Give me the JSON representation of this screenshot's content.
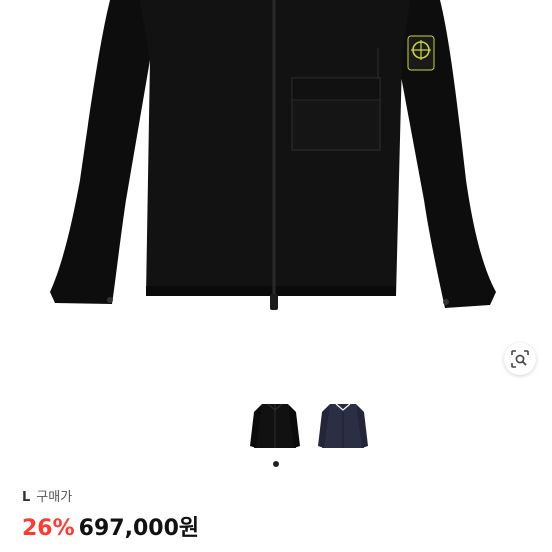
{
  "product": {
    "image_alt": "black zip-up overshirt jacket with compass badge on left sleeve"
  },
  "gallery": {
    "lens_icon": "image-search-icon",
    "thumbnails": [
      {
        "name": "black",
        "color": "#111111"
      },
      {
        "name": "navy",
        "color": "#2b2f45"
      }
    ],
    "active_index": 0
  },
  "listing": {
    "size": "L",
    "purchase_label": "구매가",
    "discount": "26%",
    "price": "697,000원"
  },
  "colors": {
    "accent": "#ff3b30",
    "badge_yellow": "#c8d43a"
  }
}
